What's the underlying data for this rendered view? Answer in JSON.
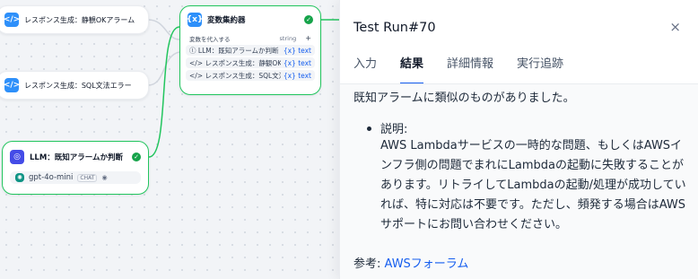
{
  "canvas": {
    "nodes": [
      {
        "title": "レスポンス生成：静観OKアラーム",
        "icon": "code-icon"
      },
      {
        "title": "レスポンス生成：SQL文法エラー",
        "icon": "code-icon"
      },
      {
        "title": "LLM：既知アラームか判断",
        "icon": "llm-icon",
        "model": "gpt-4o-mini",
        "model_badge": "CHAT"
      }
    ],
    "aggregator": {
      "title": "変数集約器",
      "assign_label": "変数を代入する",
      "type_label": "string",
      "add_symbol": "+",
      "vars": [
        {
          "label": "LLM：既知アラームか判断",
          "type": "{x} text"
        },
        {
          "label": "レスポンス生成：静観OKア...",
          "type": "{x} text"
        },
        {
          "label": "レスポンス生成：SQL文法...",
          "type": "{x} text"
        }
      ]
    }
  },
  "panel": {
    "title": "Test Run#70",
    "close": "×",
    "tabs": [
      "入力",
      "結果",
      "詳細情報",
      "実行追跡"
    ],
    "active_tab": "結果",
    "summary": "既知アラームに類似のものがありました。",
    "bullet_label": "説明:",
    "bullet_text": "AWS Lambdaサービスの一時的な問題、もしくはAWSインフラ側の問題でまれにLambdaの起動に失敗することがあります。リトライしてLambdaの起動/処理が成功していれば、特に対応は不要です。ただし、頻発する場合はAWSサポートにお問い合わせください。",
    "ref_label": "参考: ",
    "ref_link": "AWSフォーラム"
  },
  "colors": {
    "accent": "#155eef",
    "success": "#16a34a",
    "edge_active": "#22c55e"
  }
}
